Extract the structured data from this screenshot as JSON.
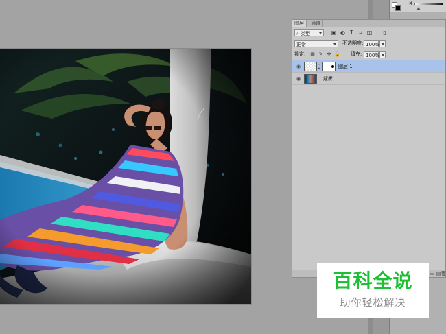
{
  "panel": {
    "tabs": [
      "图层",
      "通道"
    ],
    "filter_kind": "类型",
    "blend_mode": "正常",
    "opacity_label": "不透明度:",
    "opacity_value": "100%",
    "lock_label": "锁定:",
    "fill_label": "填充:",
    "fill_value": "100%"
  },
  "layers": [
    {
      "name": "图层 1",
      "selected": true
    },
    {
      "name": "背景",
      "selected": false
    }
  ],
  "color": {
    "channel_label": "K"
  },
  "watermark": {
    "main": "百科全说",
    "sub": "助你轻松解决"
  },
  "colors": {
    "selected_layer": "#a8c2ea",
    "watermark_green": "#1fbf35",
    "watermark_gray": "#8b8b8b"
  },
  "icons": {
    "filter_tools": [
      "image-filter-icon",
      "adjustment-filter-icon",
      "type-filter-icon",
      "shape-filter-icon",
      "smart-object-filter-icon",
      "toggle-filter-icon"
    ],
    "lock_tools": [
      "lock-transparent-icon",
      "lock-image-icon",
      "lock-position-icon",
      "lock-all-icon"
    ],
    "bottom_tools": [
      "link-layers-icon",
      "fx-icon",
      "mask-icon",
      "adjustment-layer-icon",
      "group-icon",
      "new-layer-icon",
      "trash-icon"
    ]
  }
}
